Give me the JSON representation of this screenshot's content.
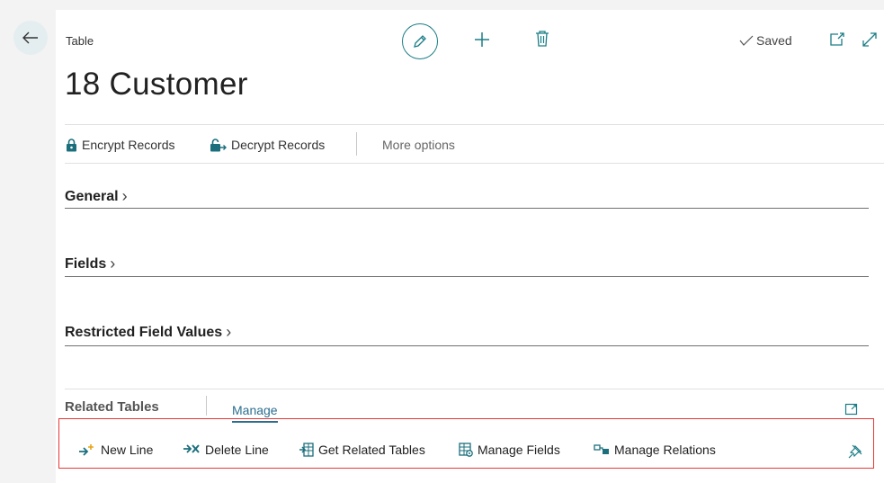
{
  "header": {
    "page_kind": "Table",
    "title": "18 Customer",
    "saved_label": "Saved"
  },
  "actions": {
    "encrypt": "Encrypt Records",
    "decrypt": "Decrypt Records",
    "more": "More options"
  },
  "sections": [
    {
      "label": "General"
    },
    {
      "label": "Fields"
    },
    {
      "label": "Restricted Field Values"
    }
  ],
  "part": {
    "title": "Related Tables",
    "tab_manage": "Manage",
    "actions": {
      "new_line": "New Line",
      "delete_line": "Delete Line",
      "get_related": "Get Related Tables",
      "manage_fields": "Manage Fields",
      "manage_relations": "Manage Relations"
    }
  },
  "colors": {
    "accent": "#1b7d86",
    "highlight_border": "#e53935",
    "link": "#2b6e8f"
  },
  "icons": [
    "back-arrow-icon",
    "pencil-icon",
    "plus-icon",
    "trash-icon",
    "checkmark-icon",
    "new-window-icon",
    "expand-icon",
    "lock-icon",
    "unlock-icon",
    "chevron-right-icon",
    "new-line-icon",
    "delete-line-icon",
    "get-related-tables-icon",
    "manage-fields-icon",
    "manage-relations-icon",
    "pin-icon"
  ]
}
